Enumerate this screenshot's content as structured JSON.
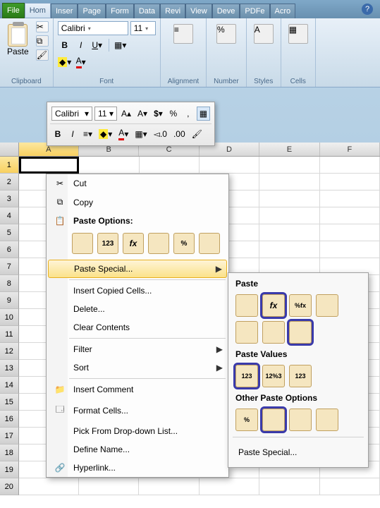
{
  "tabs": {
    "file": "File",
    "home": "Hom",
    "insert": "Inser",
    "page": "Page",
    "formulas": "Form",
    "data": "Data",
    "review": "Revi",
    "view": "View",
    "developer": "Deve",
    "pdf": "PDFe",
    "acrobat": "Acro"
  },
  "ribbon": {
    "clipboard": {
      "label": "Clipboard",
      "paste": "Paste"
    },
    "font": {
      "label": "Font",
      "name": "Calibri",
      "size": "11",
      "bold": "B",
      "italic": "I",
      "underline": "U"
    },
    "alignment": "Alignment",
    "number": "Number",
    "styles": "Styles",
    "cells": "Cells"
  },
  "mini_toolbar": {
    "font": "Calibri",
    "size": "11",
    "grow": "A▴",
    "shrink": "A▾",
    "currency": "$",
    "percent": "%",
    "comma": ",",
    "bold": "B",
    "italic": "I",
    "decrease_dec": "◅.0",
    "increase_dec": ".00"
  },
  "grid": {
    "cols": [
      "A",
      "B",
      "C",
      "D",
      "E",
      "F"
    ],
    "rows": [
      "1",
      "2",
      "3",
      "4",
      "5",
      "6",
      "7",
      "8",
      "9",
      "10",
      "11",
      "12",
      "13",
      "14",
      "15",
      "16",
      "17",
      "18",
      "19",
      "20"
    ]
  },
  "context_menu": {
    "cut": "Cut",
    "copy": "Copy",
    "paste_options": "Paste Options:",
    "paste_icons": [
      "",
      "123",
      "fx",
      "",
      "%",
      ""
    ],
    "paste_special": "Paste Special...",
    "insert_copied": "Insert Copied Cells...",
    "delete": "Delete...",
    "clear_contents": "Clear Contents",
    "filter": "Filter",
    "sort": "Sort",
    "insert_comment": "Insert Comment",
    "format_cells": "Format Cells...",
    "pick_list": "Pick From Drop-down List...",
    "define_name": "Define Name...",
    "hyperlink": "Hyperlink..."
  },
  "submenu": {
    "paste_label": "Paste",
    "paste_icons": [
      "",
      "fx",
      "%fx",
      "",
      "",
      " ",
      " ",
      ""
    ],
    "paste_values_label": "Paste Values",
    "values_icons": [
      "123",
      "12%3",
      "123"
    ],
    "other_label": "Other Paste Options",
    "other_icons": [
      "%",
      "",
      "",
      ""
    ],
    "paste_special": "Paste Special..."
  }
}
